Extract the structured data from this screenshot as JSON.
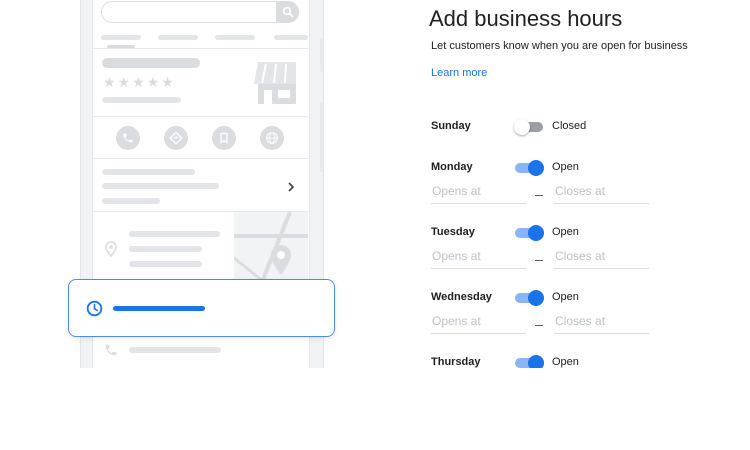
{
  "panel": {
    "title": "Add business hours",
    "subtitle": "Let customers know when you are open for business",
    "learn_more": "Learn more"
  },
  "hours": {
    "opens_placeholder": "Opens at",
    "closes_placeholder": "Closes at",
    "days": [
      {
        "name": "Sunday",
        "status": "Closed",
        "open": false
      },
      {
        "name": "Monday",
        "status": "Open",
        "open": true
      },
      {
        "name": "Tuesday",
        "status": "Open",
        "open": true
      },
      {
        "name": "Wednesday",
        "status": "Open",
        "open": true
      },
      {
        "name": "Thursday",
        "status": "Open",
        "open": true
      }
    ]
  },
  "mockup": {
    "stars": "★★★★★",
    "icons": [
      "search-icon",
      "storefront-icon",
      "phone-icon",
      "directions-icon",
      "bookmark-icon",
      "globe-icon",
      "chevron-right-icon",
      "location-pin-icon",
      "map-pin-icon",
      "clock-icon"
    ]
  },
  "colors": {
    "accent": "#1a73e8",
    "toggle_on_track": "#8ab4f8",
    "toggle_off_track": "#9aa0a6",
    "placeholder_gray": "#dadce0"
  }
}
